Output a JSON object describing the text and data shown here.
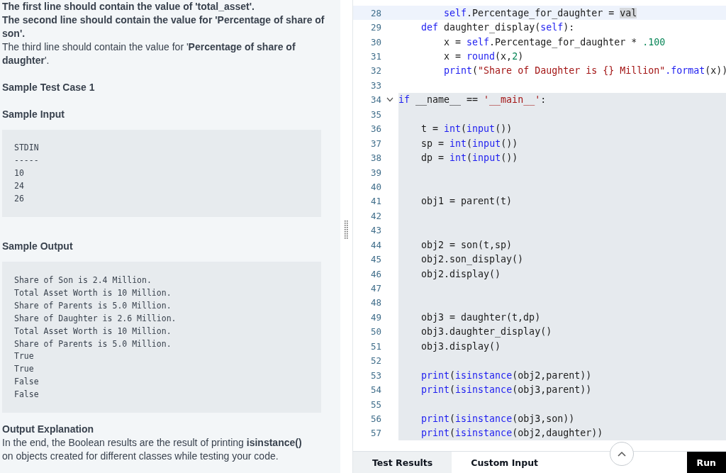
{
  "problem": {
    "paragraphs": [
      {
        "text": "The first line should contain the value of 'total_asset'.",
        "bold": true
      },
      {
        "text": "The second line should contain the value for 'Percentage of share of son'.",
        "bold": true
      },
      {
        "text": "The third line should contain the value for '**Percentage of share of daughter**'.",
        "bold": false
      }
    ],
    "test_case_title": "Sample Test Case 1",
    "input_title": "Sample Input",
    "input_lines": [
      "STDIN",
      "-----",
      "10",
      "24",
      "26"
    ],
    "output_title": "Sample Output",
    "output_lines": [
      "Share of Son is 2.4 Million.",
      "Total Asset Worth is 10 Million.",
      "Share of Parents is 5.0 Million.",
      "Share of Daughter is 2.6 Million.",
      "Total Asset Worth is 10 Million.",
      "Share of Parents is 5.0 Million.",
      "True",
      "True",
      "False",
      "False"
    ],
    "explanation_title": "Output Explanation",
    "explanation": "In the end, the Boolean results are the result of printing **isinstance()** on objects created for different classes while testing your code."
  },
  "editor": {
    "lines": [
      {
        "number": "28",
        "active": true,
        "in_scope": false,
        "tokens": [
          {
            "kind": "builtin",
            "s": "        self"
          },
          {
            "kind": "plain",
            "s": ".Percentage_for_daughter = "
          },
          {
            "kind": "selection",
            "s": "val"
          }
        ]
      },
      {
        "number": "29",
        "active": false,
        "in_scope": false,
        "tokens": [
          {
            "kind": "keyword",
            "s": "    def"
          },
          {
            "kind": "plain",
            "s": " daughter_display("
          },
          {
            "kind": "builtin",
            "s": "self"
          },
          {
            "kind": "plain",
            "s": "):"
          }
        ]
      },
      {
        "number": "30",
        "active": false,
        "in_scope": false,
        "tokens": [
          {
            "kind": "plain",
            "s": "        x = "
          },
          {
            "kind": "builtin",
            "s": "self"
          },
          {
            "kind": "plain",
            "s": ".Percentage_for_daughter * "
          },
          {
            "kind": "number",
            "s": ".100"
          }
        ]
      },
      {
        "number": "31",
        "active": false,
        "in_scope": false,
        "tokens": [
          {
            "kind": "plain",
            "s": "        x = "
          },
          {
            "kind": "builtin",
            "s": "round"
          },
          {
            "kind": "plain",
            "s": "(x,"
          },
          {
            "kind": "number",
            "s": "2"
          },
          {
            "kind": "plain",
            "s": ")"
          }
        ]
      },
      {
        "number": "32",
        "active": false,
        "in_scope": false,
        "tokens": [
          {
            "kind": "builtin",
            "s": "        print"
          },
          {
            "kind": "plain",
            "s": "("
          },
          {
            "kind": "string",
            "s": "\"Share of Daughter is {} Million\""
          },
          {
            "kind": "builtin",
            "s": ".format"
          },
          {
            "kind": "plain",
            "s": "(x))"
          }
        ]
      },
      {
        "number": "33",
        "active": false,
        "in_scope": false
      },
      {
        "number": "34",
        "active": false,
        "in_scope": true,
        "expanded": true,
        "tokens": [
          {
            "kind": "keyword",
            "s": "if"
          },
          {
            "kind": "plain",
            "s": " __name__ == "
          },
          {
            "kind": "string",
            "s": "'__main__'"
          },
          {
            "kind": "plain",
            "s": ":"
          }
        ]
      },
      {
        "number": "35",
        "active": false,
        "in_scope": true
      },
      {
        "number": "36",
        "active": false,
        "in_scope": true,
        "tokens": [
          {
            "kind": "plain",
            "s": "    t = "
          },
          {
            "kind": "builtin",
            "s": "int"
          },
          {
            "kind": "plain",
            "s": "("
          },
          {
            "kind": "builtin",
            "s": "input"
          },
          {
            "kind": "plain",
            "s": "())"
          }
        ]
      },
      {
        "number": "37",
        "active": false,
        "in_scope": true,
        "tokens": [
          {
            "kind": "plain",
            "s": "    sp = "
          },
          {
            "kind": "builtin",
            "s": "int"
          },
          {
            "kind": "plain",
            "s": "("
          },
          {
            "kind": "builtin",
            "s": "input"
          },
          {
            "kind": "plain",
            "s": "())"
          }
        ]
      },
      {
        "number": "38",
        "active": false,
        "in_scope": true,
        "tokens": [
          {
            "kind": "plain",
            "s": "    dp = "
          },
          {
            "kind": "builtin",
            "s": "int"
          },
          {
            "kind": "plain",
            "s": "("
          },
          {
            "kind": "builtin",
            "s": "input"
          },
          {
            "kind": "plain",
            "s": "())"
          }
        ]
      },
      {
        "number": "39",
        "active": false,
        "in_scope": true
      },
      {
        "number": "40",
        "active": false,
        "in_scope": true
      },
      {
        "number": "41",
        "active": false,
        "in_scope": true,
        "tokens": [
          {
            "kind": "plain",
            "s": "    obj1 = parent(t)"
          }
        ]
      },
      {
        "number": "42",
        "active": false,
        "in_scope": true
      },
      {
        "number": "43",
        "active": false,
        "in_scope": true
      },
      {
        "number": "44",
        "active": false,
        "in_scope": true,
        "tokens": [
          {
            "kind": "plain",
            "s": "    obj2 = son(t,sp)"
          }
        ]
      },
      {
        "number": "45",
        "active": false,
        "in_scope": true,
        "tokens": [
          {
            "kind": "plain",
            "s": "    obj2.son_display()"
          }
        ]
      },
      {
        "number": "46",
        "active": false,
        "in_scope": true,
        "tokens": [
          {
            "kind": "plain",
            "s": "    obj2.display()"
          }
        ]
      },
      {
        "number": "47",
        "active": false,
        "in_scope": true
      },
      {
        "number": "48",
        "active": false,
        "in_scope": true
      },
      {
        "number": "49",
        "active": false,
        "in_scope": true,
        "tokens": [
          {
            "kind": "plain",
            "s": "    obj3 = daughter(t,dp)"
          }
        ]
      },
      {
        "number": "50",
        "active": false,
        "in_scope": true,
        "tokens": [
          {
            "kind": "plain",
            "s": "    obj3.daughter_display()"
          }
        ]
      },
      {
        "number": "51",
        "active": false,
        "in_scope": true,
        "tokens": [
          {
            "kind": "plain",
            "s": "    obj3.display()"
          }
        ]
      },
      {
        "number": "52",
        "active": false,
        "in_scope": true
      },
      {
        "number": "53",
        "active": false,
        "in_scope": true,
        "tokens": [
          {
            "kind": "builtin",
            "s": "    print"
          },
          {
            "kind": "plain",
            "s": "("
          },
          {
            "kind": "builtin",
            "s": "isinstance"
          },
          {
            "kind": "plain",
            "s": "(obj2,parent))"
          }
        ]
      },
      {
        "number": "54",
        "active": false,
        "in_scope": true,
        "tokens": [
          {
            "kind": "builtin",
            "s": "    print"
          },
          {
            "kind": "plain",
            "s": "("
          },
          {
            "kind": "builtin",
            "s": "isinstance"
          },
          {
            "kind": "plain",
            "s": "(obj3,parent))"
          }
        ]
      },
      {
        "number": "55",
        "active": false,
        "in_scope": true
      },
      {
        "number": "56",
        "active": false,
        "in_scope": true,
        "tokens": [
          {
            "kind": "builtin",
            "s": "    print"
          },
          {
            "kind": "plain",
            "s": "("
          },
          {
            "kind": "builtin",
            "s": "isinstance"
          },
          {
            "kind": "plain",
            "s": "(obj3,son))"
          }
        ]
      },
      {
        "number": "57",
        "active": false,
        "in_scope": true,
        "tokens": [
          {
            "kind": "builtin",
            "s": "    print"
          },
          {
            "kind": "plain",
            "s": "("
          },
          {
            "kind": "builtin",
            "s": "isinstance"
          },
          {
            "kind": "plain",
            "s": "(obj2,daughter))"
          }
        ]
      }
    ]
  },
  "bottom_bar": {
    "tabs": [
      {
        "label": "Test Results",
        "selected": false
      },
      {
        "label": "Custom Input",
        "selected": true
      }
    ],
    "run_button": "Run"
  }
}
